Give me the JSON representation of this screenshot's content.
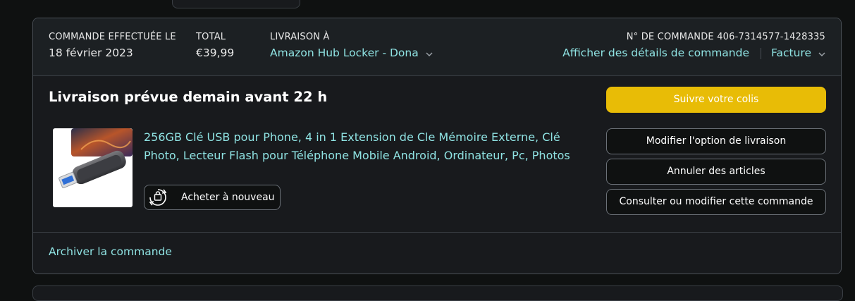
{
  "order": {
    "placed_label": "COMMANDE EFFECTUÉE LE",
    "placed_value": "18 février 2023",
    "total_label": "TOTAL",
    "total_value": "€39,99",
    "ship_label": "LIVRAISON À",
    "ship_value": "Amazon Hub Locker - Dona",
    "order_number_label": "N° DE COMMANDE",
    "order_number": "406-7314577-1428335",
    "details_link": "Afficher des détails de commande",
    "invoice_link": "Facture"
  },
  "delivery": {
    "title": "Livraison prévue demain avant 22 h"
  },
  "product": {
    "title": "256GB Clé USB pour Phone, 4 in 1 Extension de Cle Mémoire Externe, Clé Photo, Lecteur Flash pour Téléphone Mobile Android, Ordinateur, Pc, Photos",
    "rebuy_label": "Acheter à nouveau"
  },
  "actions": {
    "track": "Suivre votre colis",
    "modify_delivery": "Modifier l'option de livraison",
    "cancel_items": "Annuler des articles",
    "view_edit_order": "Consulter ou modifier cette commande"
  },
  "footer": {
    "archive": "Archiver la commande"
  },
  "colors": {
    "background": "#0f1111",
    "card": "#181a1d",
    "link": "#8fe3e3",
    "primary_button": "#e8bc06"
  },
  "icons": {
    "ship_dropdown": "chevron-down-icon",
    "invoice_dropdown": "chevron-down-icon",
    "rebuy": "rebuy-cycle-icon"
  }
}
